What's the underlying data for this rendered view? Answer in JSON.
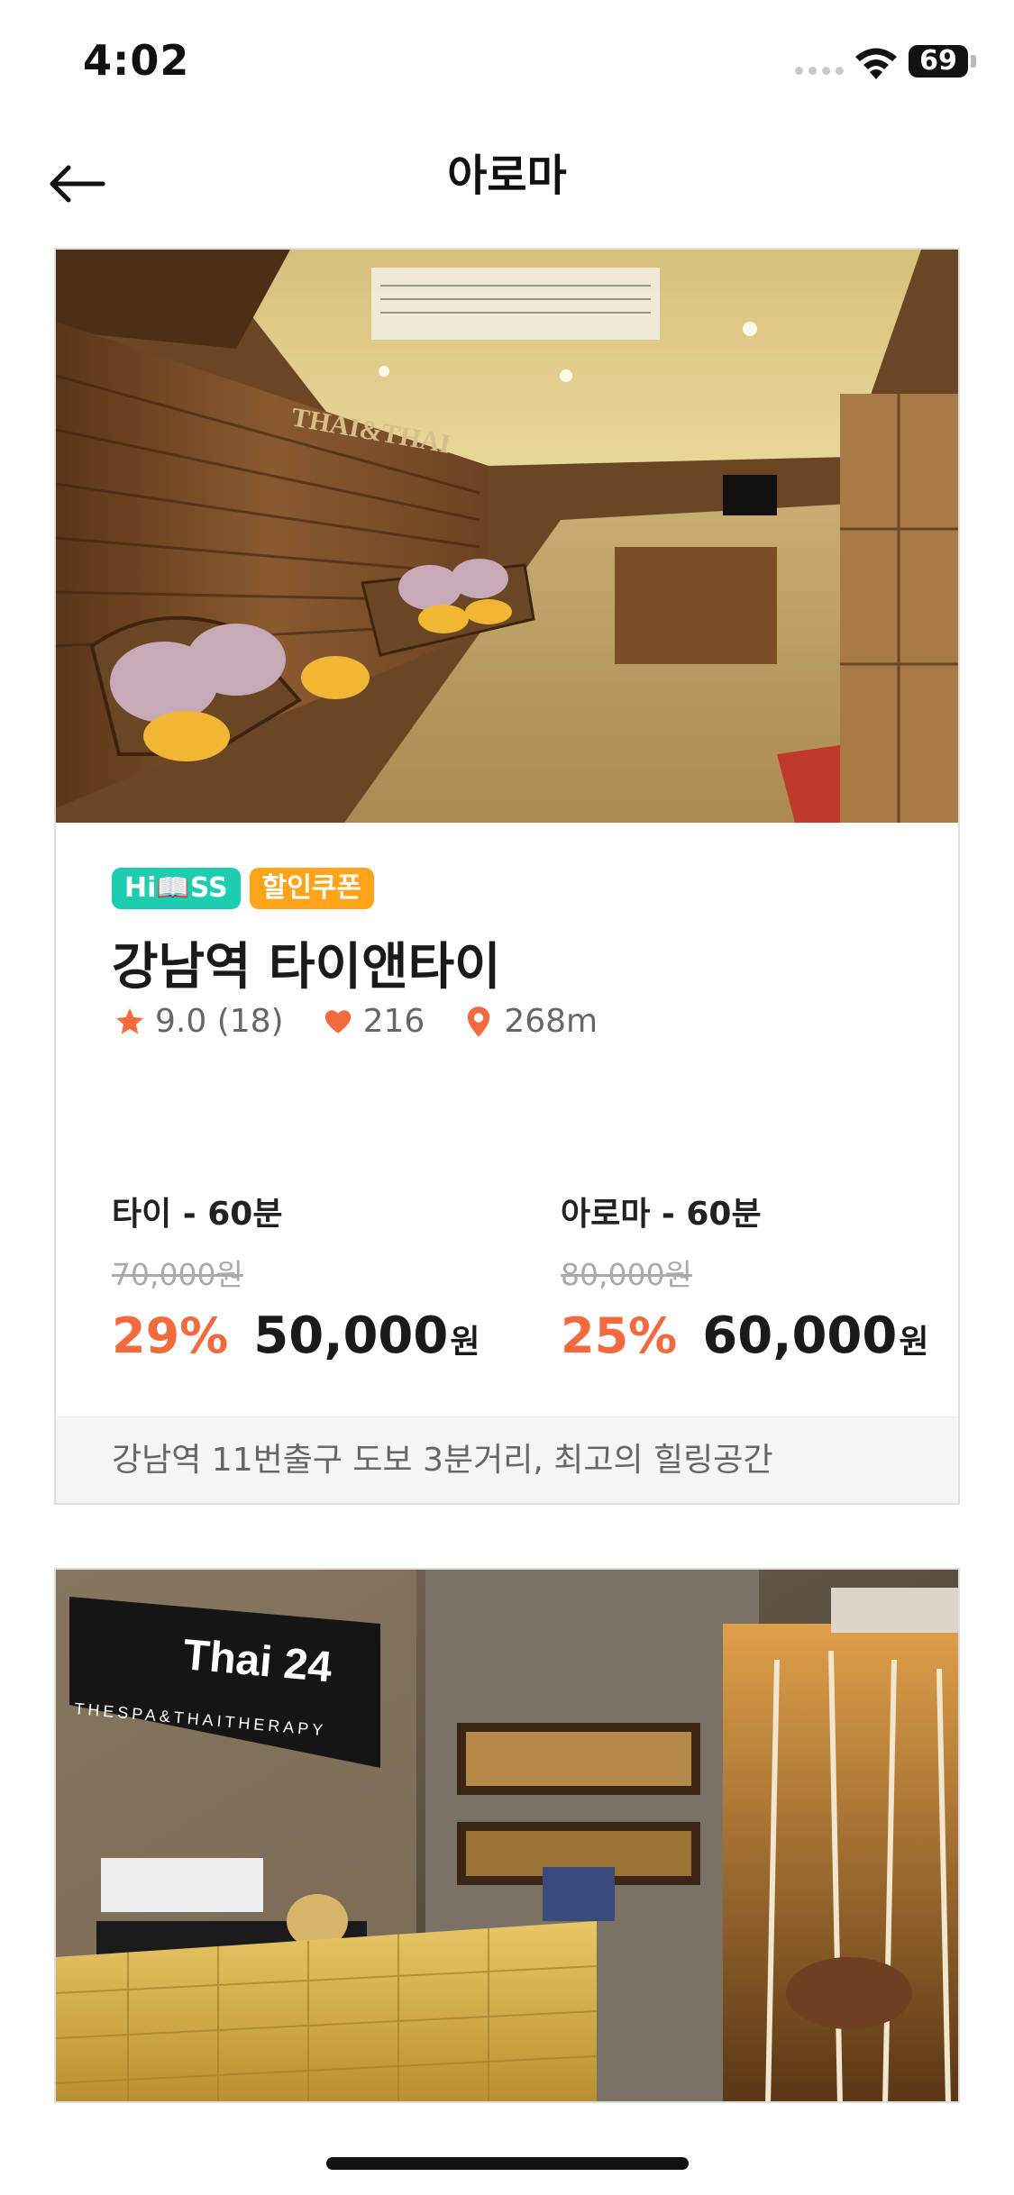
{
  "status_bar": {
    "time": "4:02",
    "battery": "69"
  },
  "header": {
    "title": "아로마",
    "back_icon": "arrow-left-icon"
  },
  "shops": [
    {
      "badges": [
        "Hi📖SS",
        "할인쿠폰"
      ],
      "name": "강남역 타이앤타이",
      "rating": "9.0 (18)",
      "likes": "216",
      "distance": "268m",
      "courses": [
        {
          "name": "타이 - 60분",
          "original_price": "70,000원",
          "discount": "29%",
          "price": "50,000",
          "unit": "원"
        },
        {
          "name": "아로마 - 60분",
          "original_price": "80,000원",
          "discount": "25%",
          "price": "60,000",
          "unit": "원"
        }
      ],
      "description": "강남역 11번출구 도보 3분거리, 최고의 힐링공간",
      "photo_sign": "THAI&THAI"
    },
    {
      "photo_sign": "Thai 24",
      "photo_subsign": "THESPA&THAITHERAPY"
    }
  ],
  "colors": {
    "accent": "#f26a3d",
    "pass_badge": "#1ccdb0",
    "coupon_badge": "#ffa41a",
    "star": "#f26a3d"
  }
}
